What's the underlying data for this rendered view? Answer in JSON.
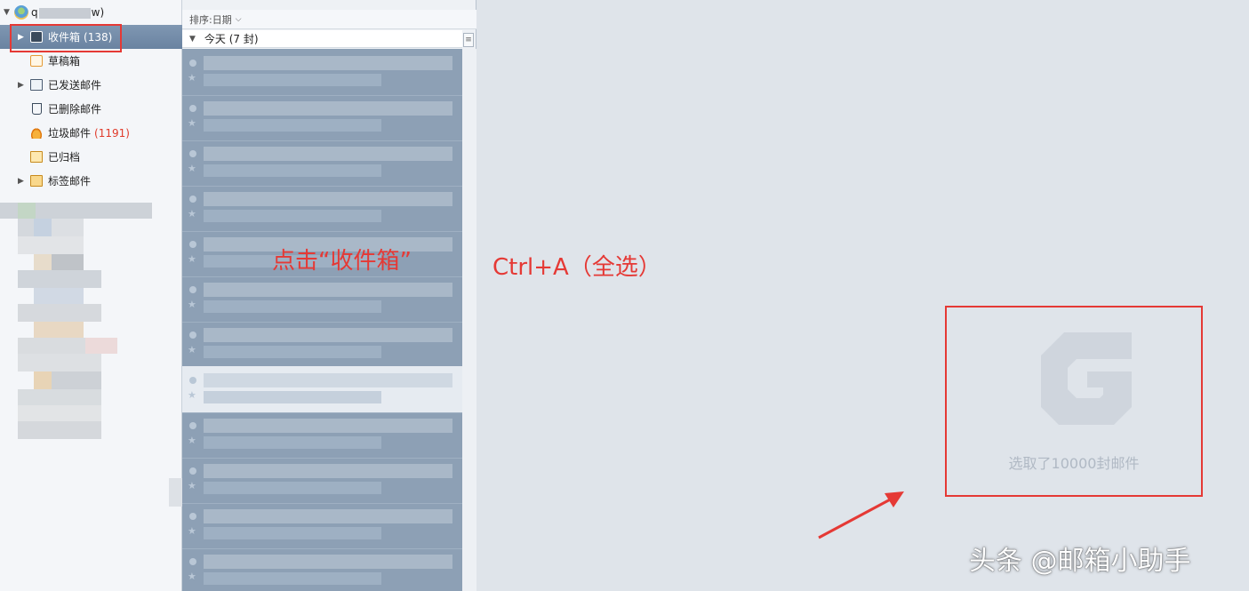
{
  "account": {
    "name_prefix": "q",
    "name_suffix": "w)"
  },
  "folders": [
    {
      "label": "收件箱",
      "count": "(138)",
      "icon": "inbox-icon",
      "active": true,
      "expandable": true
    },
    {
      "label": "草稿箱",
      "count": "",
      "icon": "draft-icon",
      "active": false,
      "expandable": false
    },
    {
      "label": "已发送邮件",
      "count": "",
      "icon": "sent-icon",
      "active": false,
      "expandable": true
    },
    {
      "label": "已删除邮件",
      "count": "",
      "icon": "trash-icon",
      "active": false,
      "expandable": false
    },
    {
      "label": "垃圾邮件",
      "count": "(1191)",
      "icon": "spam-icon",
      "active": false,
      "expandable": false
    },
    {
      "label": "已归档",
      "count": "",
      "icon": "archive-icon",
      "active": false,
      "expandable": false
    },
    {
      "label": "标签邮件",
      "count": "",
      "icon": "tag-icon",
      "active": false,
      "expandable": true
    }
  ],
  "list": {
    "sort_label": "排序:日期",
    "group_label": "今天 (7 封)",
    "menu_glyph": "≡"
  },
  "reading": {
    "selected_count_text": "选取了10000封邮件"
  },
  "annotations": {
    "click_inbox": "点击“收件箱”",
    "ctrl_a": "Ctrl+A（全选）"
  },
  "watermark": "头条 @邮箱小助手",
  "colors": {
    "accent_red": "#e53935",
    "selected_folder_bg": "#6a83a1",
    "spam_count": "#e03b2b"
  }
}
